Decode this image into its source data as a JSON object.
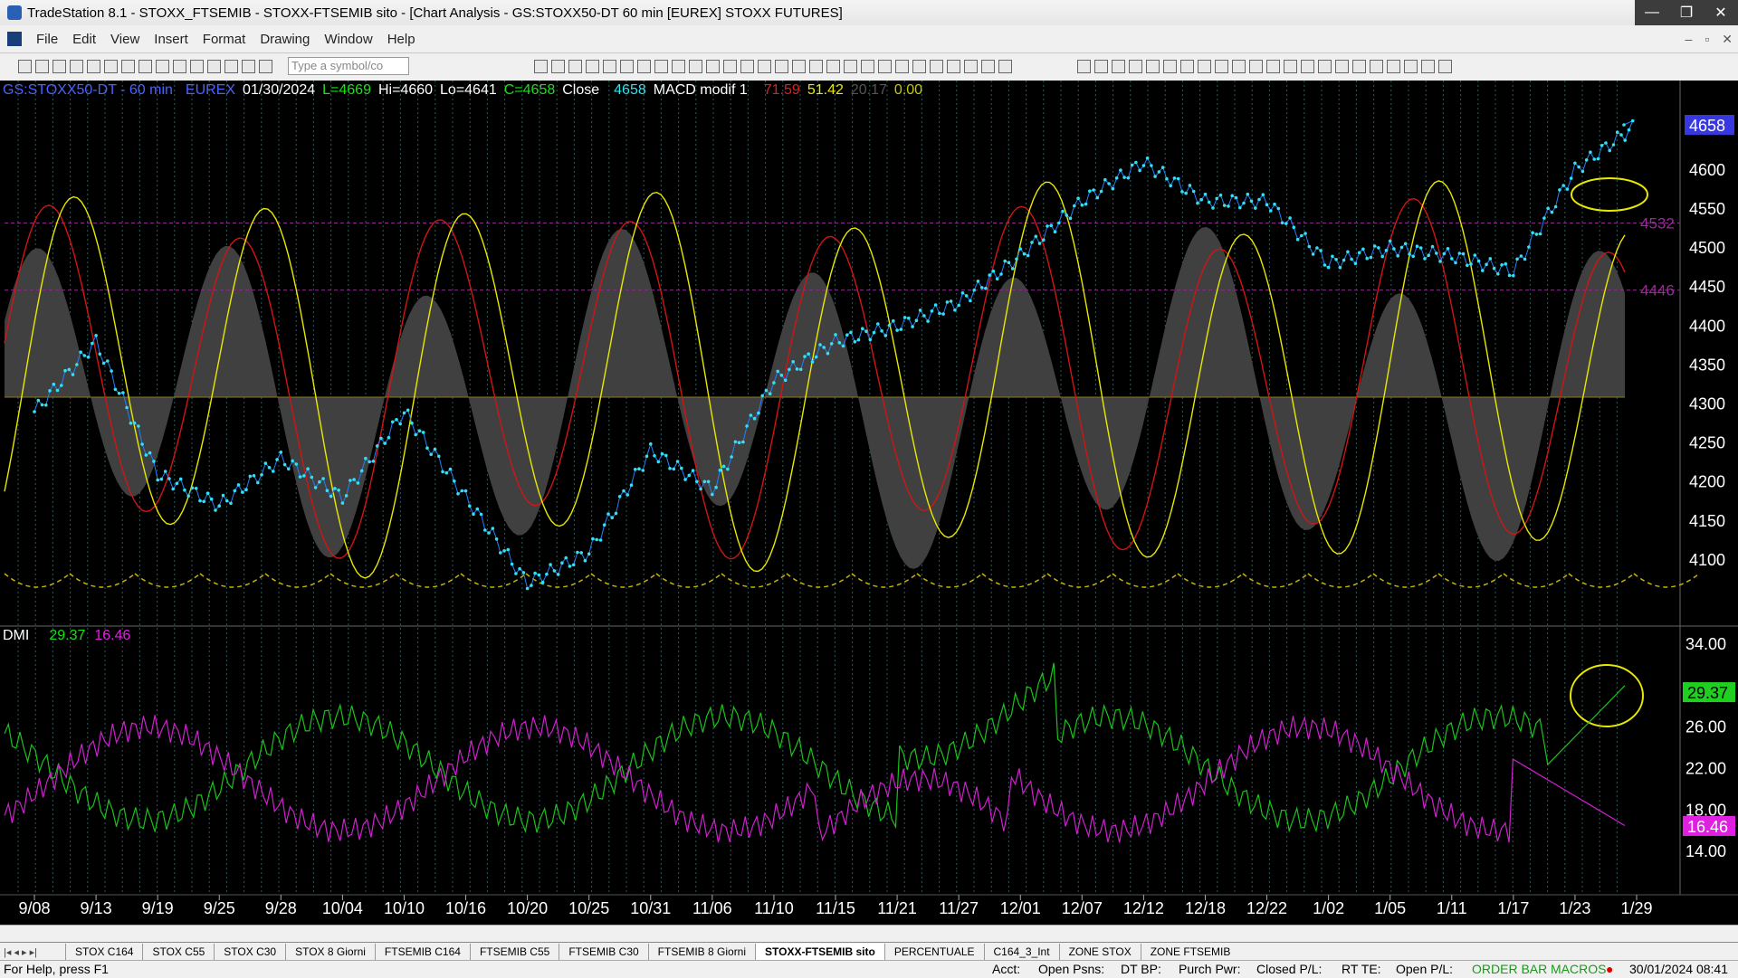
{
  "window": {
    "title": "TradeStation 8.1 - STOXX_FTSEMIB - STOXX-FTSEMIB sito - [Chart Analysis - GS:STOXX50-DT  60 min  [EUREX] STOXX FUTURES]",
    "controls": [
      "—",
      "❐",
      "✕"
    ]
  },
  "menu": {
    "items": [
      "File",
      "Edit",
      "View",
      "Insert",
      "Format",
      "Drawing",
      "Window",
      "Help"
    ],
    "mdi_controls": [
      "–",
      "▫",
      "✕"
    ]
  },
  "toolbar": {
    "symbol_placeholder": "Type a symbol/co"
  },
  "info": {
    "symbol": "GS:STOXX50-DT - 60 min",
    "exchange": "EUREX",
    "date": "01/30/2024",
    "last": "L=4669",
    "high": "Hi=4660",
    "low": "Lo=4641",
    "close": "C=4658",
    "close_label": "Close",
    "close_value": "4658",
    "indicator": "MACD modif 1",
    "v1": "71.59",
    "v2": "51.42",
    "v3": "20.17",
    "v4": "0.00"
  },
  "dmi": {
    "label": "DMI",
    "plus": "29.37",
    "minus": "16.46"
  },
  "price_axis": {
    "labels": [
      "4600",
      "4550",
      "4500",
      "4450",
      "4400",
      "4350",
      "4300",
      "4250",
      "4200",
      "4150",
      "4100"
    ],
    "current": "4658",
    "levels": [
      "4532",
      "4446"
    ]
  },
  "dmi_axis": {
    "labels": [
      "34.00",
      "26.00",
      "22.00",
      "18.00",
      "14.00"
    ],
    "plus_box": "29.37",
    "minus_box": "16.46"
  },
  "date_axis": [
    "9/08",
    "9/13",
    "9/19",
    "9/25",
    "9/28",
    "10/04",
    "10/10",
    "10/16",
    "10/20",
    "10/25",
    "10/31",
    "11/06",
    "11/10",
    "11/15",
    "11/21",
    "11/27",
    "12/01",
    "12/07",
    "12/12",
    "12/18",
    "12/22",
    "1/02",
    "1/05",
    "1/11",
    "1/17",
    "1/23",
    "1/29"
  ],
  "colors": {
    "price": "#33e0f0",
    "red_line": "#d01515",
    "yellow_line": "#e8e800",
    "plus_di": "#19c419",
    "minus_di": "#d020d0",
    "level_line": "#8a2a8a"
  },
  "tabs": {
    "items": [
      "STOX C164",
      "STOX C55",
      "STOX  C30",
      "STOX  8 Giorni",
      "FTSEMIB C164",
      "FTSEMIB C55",
      "FTSEMIB C30",
      "FTSEMIB  8 Giorni",
      "STOXX-FTSEMIB sito",
      "PERCENTUALE",
      "C164_3_Int",
      "ZONE STOX",
      "ZONE FTSEMIB"
    ],
    "active": "STOXX-FTSEMIB sito"
  },
  "status": {
    "help": "For Help, press F1",
    "acct": "Acct:",
    "open_psns": "Open Psns:",
    "dt_bp": "DT BP:",
    "purch_pwr": "Purch Pwr:",
    "closed_pl": "Closed P/L:",
    "rt_te": "RT TE:",
    "open_pl": "Open P/L:",
    "order_bar": "ORDER BAR",
    "macros": "MACROS",
    "datetime": "30/01/2024 08:41"
  },
  "chart_data": {
    "type": "line",
    "title": "GS:STOXX50-DT - 60 min",
    "price_range": [
      4050,
      4680
    ],
    "price_keypoints": [
      [
        "9/08",
        4290
      ],
      [
        "9/13",
        4380
      ],
      [
        "9/19",
        4210
      ],
      [
        "9/25",
        4170
      ],
      [
        "9/28",
        4230
      ],
      [
        "10/04",
        4180
      ],
      [
        "10/10",
        4290
      ],
      [
        "10/16",
        4180
      ],
      [
        "10/20",
        4070
      ],
      [
        "10/25",
        4110
      ],
      [
        "10/31",
        4240
      ],
      [
        "11/06",
        4190
      ],
      [
        "11/10",
        4330
      ],
      [
        "11/15",
        4380
      ],
      [
        "11/21",
        4400
      ],
      [
        "11/27",
        4430
      ],
      [
        "12/01",
        4490
      ],
      [
        "12/07",
        4560
      ],
      [
        "12/12",
        4610
      ],
      [
        "12/18",
        4560
      ],
      [
        "12/22",
        4560
      ],
      [
        "1/02",
        4480
      ],
      [
        "1/05",
        4500
      ],
      [
        "1/11",
        4490
      ],
      [
        "1/17",
        4470
      ],
      [
        "1/23",
        4600
      ],
      [
        "1/29",
        4658
      ]
    ],
    "dmi_range": [
      10,
      34
    ],
    "series": [
      {
        "name": "DMI+",
        "last": 29.37
      },
      {
        "name": "DMI-",
        "last": 16.46
      }
    ]
  }
}
